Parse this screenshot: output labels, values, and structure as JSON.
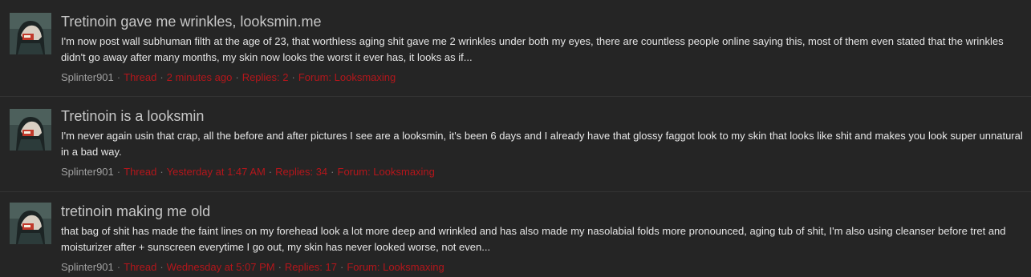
{
  "colors": {
    "background": "#252525",
    "title": "#c7c7c7",
    "snippet": "#e6e6e6",
    "author": "#a0a0a0",
    "meta_accent": "#b4161b"
  },
  "results": [
    {
      "title": "Tretinoin gave me wrinkles, looksmin.me",
      "snippet": "I'm now post wall subhuman filth at the age of 23, that worthless aging shit gave me 2 wrinkles under both my eyes, there are countless people online saying this, most of them even stated that the wrinkles didn't go away after many months, my skin now looks the worst it ever has, it looks as if...",
      "author": "Splinter901",
      "type": "Thread",
      "time": "2 minutes ago",
      "replies": "Replies: 2",
      "forum": "Forum: Looksmaxing",
      "avatar_icon": "user-avatar"
    },
    {
      "title": "Tretinoin is a looksmin",
      "snippet": "I'm never again usin that crap, all the before and after pictures I see are a looksmin, it's been 6 days and I already have that glossy faggot look to my skin that looks like shit and makes you look super unnatural in a bad way.",
      "author": "Splinter901",
      "type": "Thread",
      "time": "Yesterday at 1:47 AM",
      "replies": "Replies: 34",
      "forum": "Forum: Looksmaxing",
      "avatar_icon": "user-avatar"
    },
    {
      "title": "tretinoin making me old",
      "snippet": "that bag of shit has made the faint lines on my forehead look a lot more deep and wrinkled and has also made my nasolabial folds more pronounced, aging tub of shit, I'm also using cleanser before tret and moisturizer after + sunscreen everytime I go out, my skin has never looked worse, not even...",
      "author": "Splinter901",
      "type": "Thread",
      "time": "Wednesday at 5:07 PM",
      "replies": "Replies: 17",
      "forum": "Forum: Looksmaxing",
      "avatar_icon": "user-avatar"
    }
  ]
}
